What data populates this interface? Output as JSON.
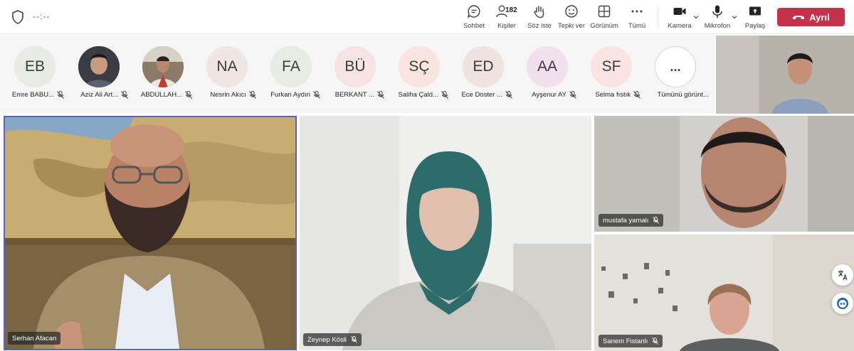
{
  "header": {
    "timer": "--:--",
    "people_count": "182",
    "buttons": {
      "chat": "Sohbet",
      "people": "Kişiler",
      "raise_hand": "Söz iste",
      "react": "Tepki ver",
      "view": "Görünüm",
      "more": "Tümü",
      "camera": "Kamera",
      "mic": "Mikrofon",
      "share": "Paylaş",
      "leave": "Ayrıl"
    }
  },
  "participants": [
    {
      "initials": "EB",
      "name": "Emre BABU...",
      "color": "#e8ebe4"
    },
    {
      "initials": "",
      "name": "Aziz Ali Art...",
      "color": "#cfd8e3"
    },
    {
      "initials": "",
      "name": "ABDULLAH...",
      "color": "#d9cfc4"
    },
    {
      "initials": "NA",
      "name": "Nesrin Akıcı",
      "color": "#efe6e3"
    },
    {
      "initials": "FA",
      "name": "Furkan Aydın",
      "color": "#e6ece1"
    },
    {
      "initials": "BÜ",
      "name": "BERKANT ...",
      "color": "#f7e3e4"
    },
    {
      "initials": "SÇ",
      "name": "Saliha Çald...",
      "color": "#f9e4df"
    },
    {
      "initials": "ED",
      "name": "Ece Doster ...",
      "color": "#efe2df"
    },
    {
      "initials": "AA",
      "name": "Ayşenur AY",
      "color": "#f1e1ef"
    },
    {
      "initials": "SF",
      "name": "Selma fıstık",
      "color": "#f9e4e1"
    },
    {
      "initials": "...",
      "name": "Tümünü görünt...",
      "color": "#ffffff"
    }
  ],
  "tiles": {
    "main": {
      "name": "Serhan Afacan"
    },
    "center": {
      "name": "Zeynep Kösli"
    },
    "top_right": {
      "name": "mustafa yamalı"
    },
    "bottom_right": {
      "name": "Sanem Fistanlı"
    }
  },
  "colors": {
    "accent": "#5b5fc7",
    "leave": "#c4314b"
  }
}
